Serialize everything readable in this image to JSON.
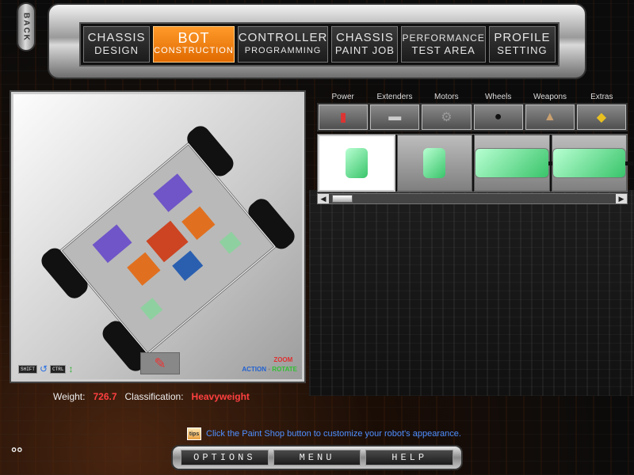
{
  "nav": {
    "back_label": "BACK",
    "tabs": [
      {
        "line1": "CHASSIS",
        "line2": "DESIGN",
        "active": false
      },
      {
        "line1": "BOT",
        "line2": "CONSTRUCTION",
        "active": true
      },
      {
        "line1": "CONTROLLER",
        "line2": "PROGRAMMING",
        "active": false
      },
      {
        "line1": "CHASSIS",
        "line2": "PAINT JOB",
        "active": false
      },
      {
        "line1": "PERFORMANCE",
        "line2": "TEST AREA",
        "active": false
      },
      {
        "line1": "PROFILE",
        "line2": "SETTING",
        "active": false
      }
    ]
  },
  "viewport": {
    "shift_key": "SHIFT",
    "ctrl_key": "CTRL",
    "action_label": "ACTION",
    "zoom_label": "ZOOM",
    "rotate_label": "ROTATE"
  },
  "parts": {
    "categories": [
      "Power",
      "Extenders",
      "Motors",
      "Wheels",
      "Weapons",
      "Extras"
    ],
    "items_count_visible": 4
  },
  "stats": {
    "weight_label": "Weight:",
    "weight_value": "726.7",
    "class_label": "Classification:",
    "class_value": "Heavyweight"
  },
  "hint": {
    "icon_text": "tips",
    "text": "Click the Paint Shop button to customize your robot's appearance."
  },
  "bottom": {
    "options": "OPTIONS",
    "menu": "MENU",
    "help": "HELP"
  },
  "colors": {
    "accent": "#ff8a1a",
    "value_red": "#ff4040",
    "hint_blue": "#4f8fff"
  }
}
